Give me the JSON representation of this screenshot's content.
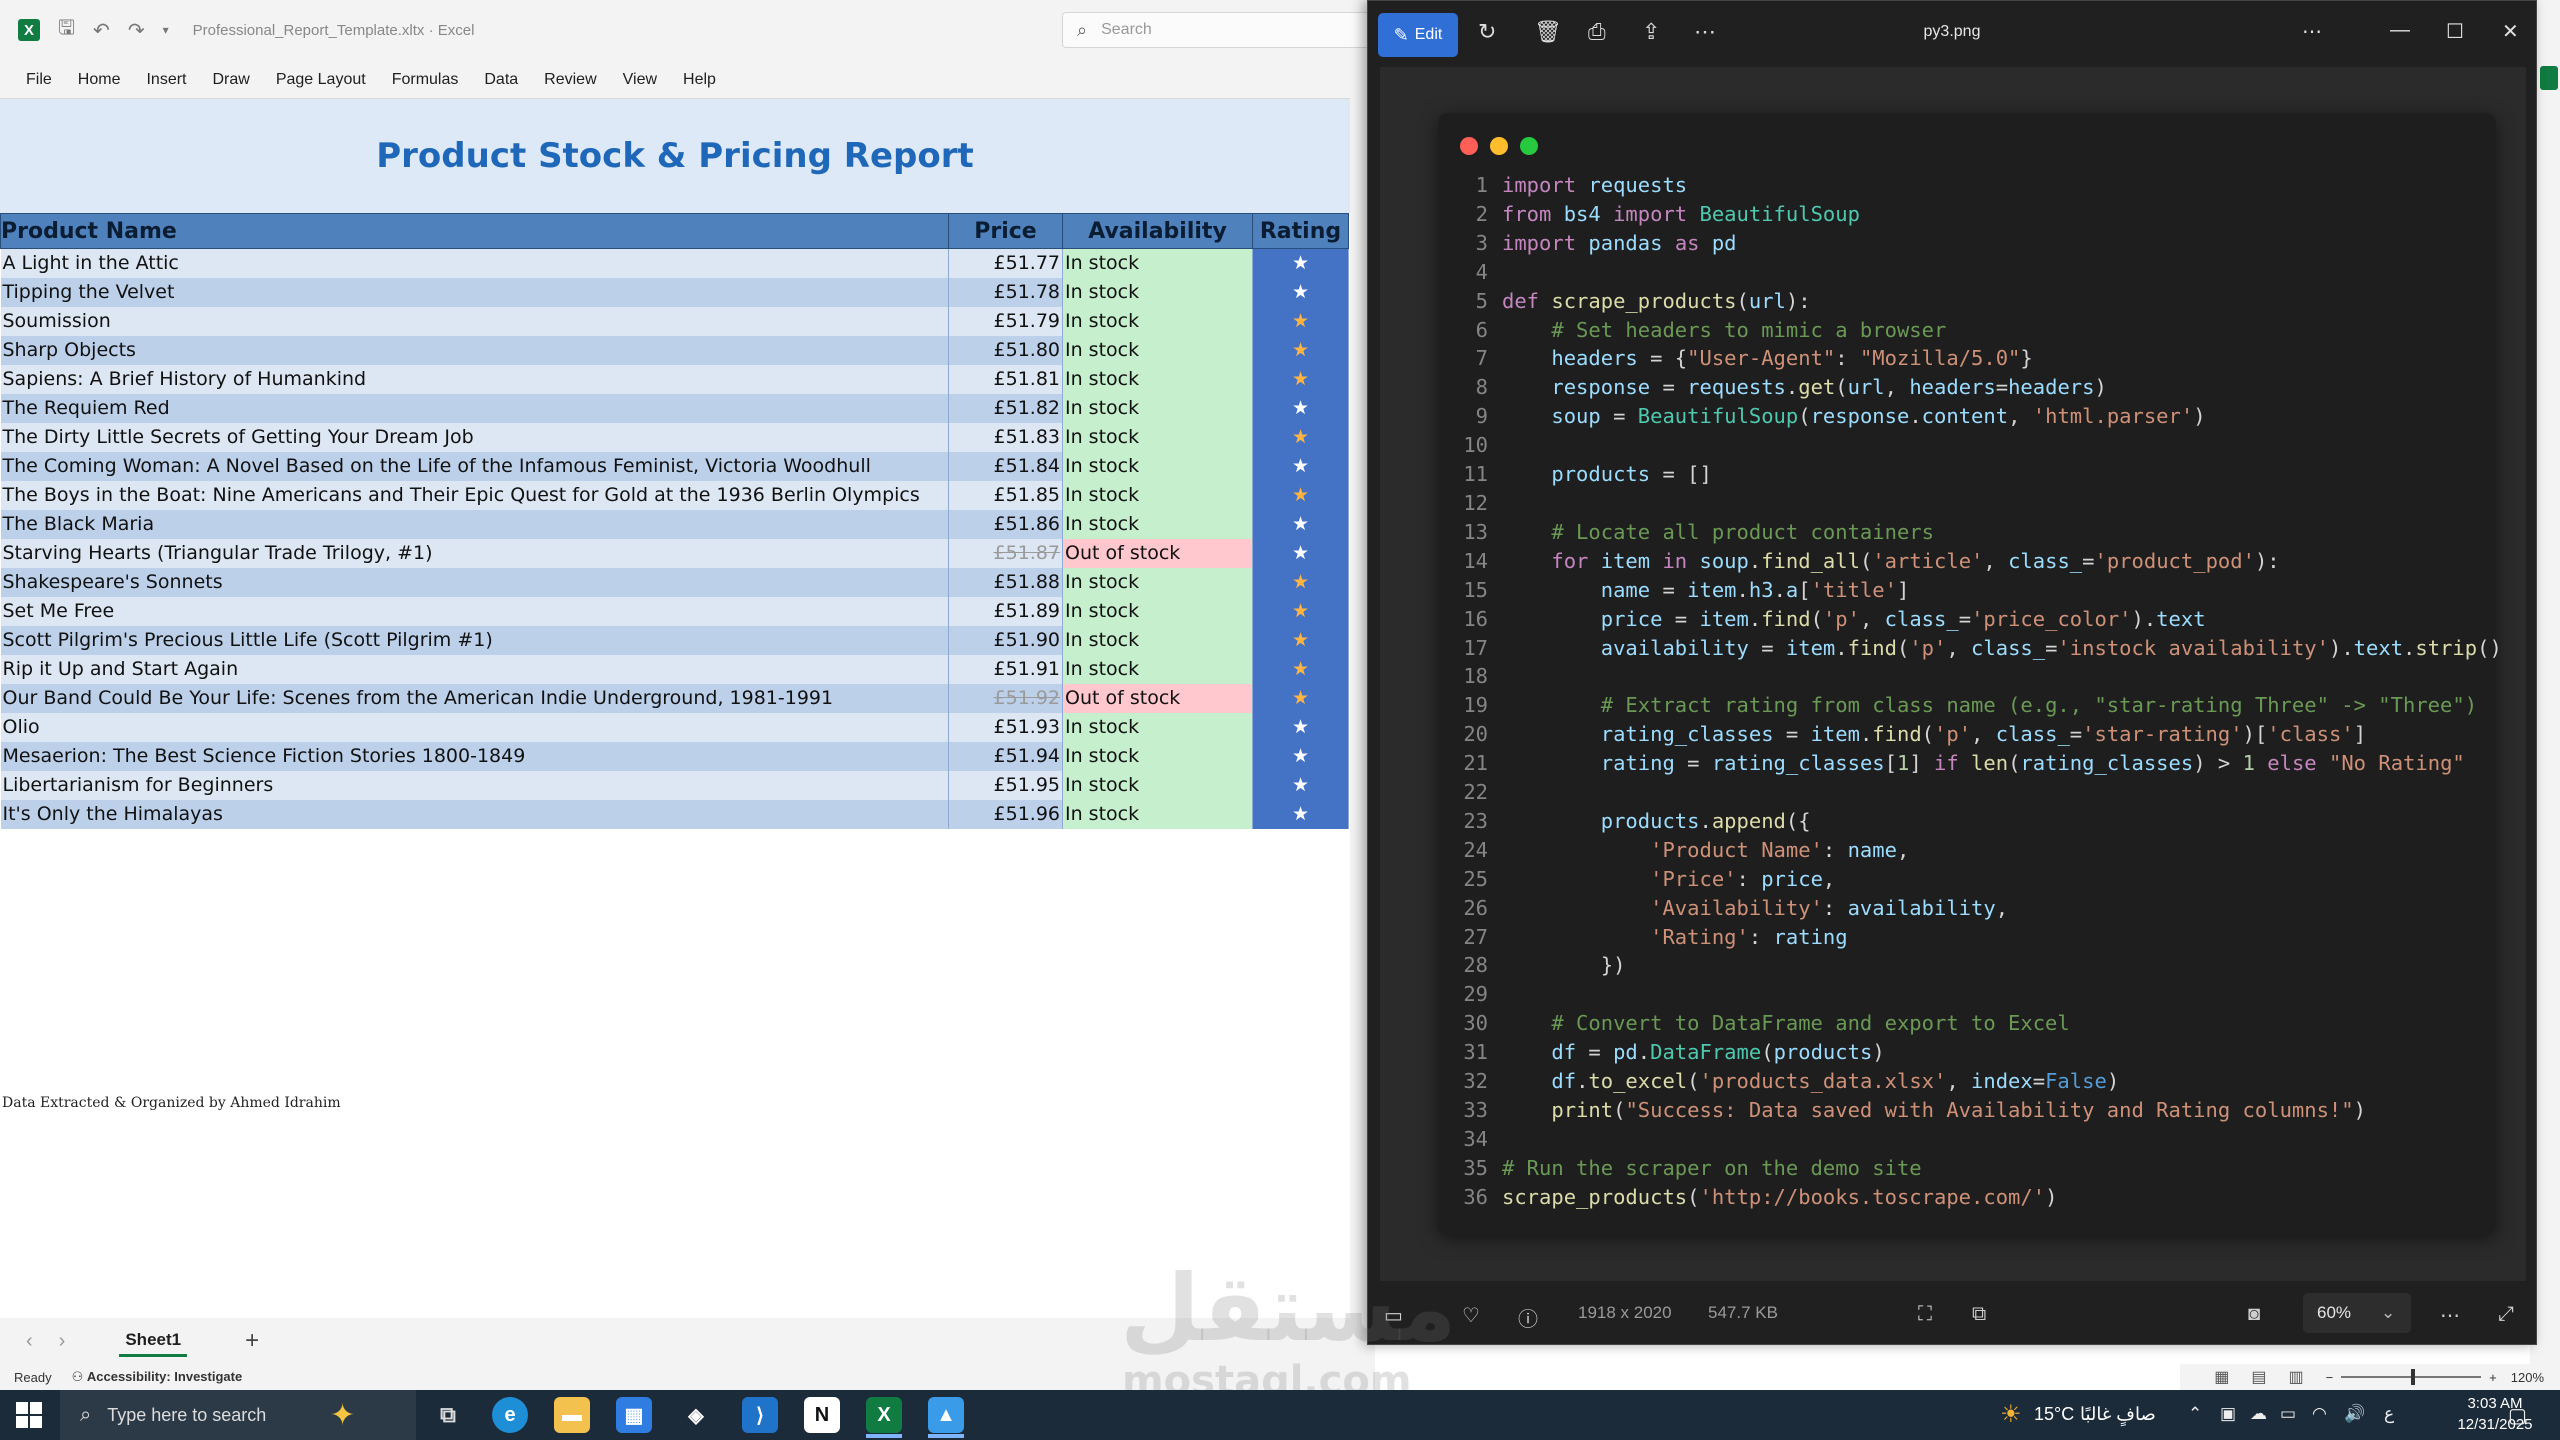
{
  "excel": {
    "file_name": "Professional_Report_Template.xltx",
    "app_name": "Excel",
    "search_placeholder": "Search",
    "menu": [
      "File",
      "Home",
      "Insert",
      "Draw",
      "Page Layout",
      "Formulas",
      "Data",
      "Review",
      "View",
      "Help"
    ],
    "report_title": "Product Stock & Pricing Report",
    "columns": [
      "Product Name",
      "Price",
      "Availability",
      "Rating"
    ],
    "rows": [
      {
        "name": "A Light in the Attic",
        "price": "£51.77",
        "availability": "In stock",
        "rating": "★",
        "star": "white"
      },
      {
        "name": "Tipping the Velvet",
        "price": "£51.78",
        "availability": "In stock",
        "rating": "★",
        "star": "white"
      },
      {
        "name": "Soumission",
        "price": "£51.79",
        "availability": "In stock",
        "rating": "★",
        "star": "orange"
      },
      {
        "name": "Sharp Objects",
        "price": "£51.80",
        "availability": "In stock",
        "rating": "★",
        "star": "orange"
      },
      {
        "name": "Sapiens: A Brief History of Humankind",
        "price": "£51.81",
        "availability": "In stock",
        "rating": "★",
        "star": "orange"
      },
      {
        "name": "The Requiem Red",
        "price": "£51.82",
        "availability": "In stock",
        "rating": "★",
        "star": "white"
      },
      {
        "name": "The Dirty Little Secrets of Getting Your Dream Job",
        "price": "£51.83",
        "availability": "In stock",
        "rating": "★",
        "star": "orange"
      },
      {
        "name": "The Coming Woman: A Novel Based on the Life of the Infamous Feminist, Victoria Woodhull",
        "price": "£51.84",
        "availability": "In stock",
        "rating": "★",
        "star": "white"
      },
      {
        "name": "The Boys in the Boat: Nine Americans and Their Epic Quest for Gold at the 1936 Berlin Olympics",
        "price": "£51.85",
        "availability": "In stock",
        "rating": "★",
        "star": "orange"
      },
      {
        "name": "The Black Maria",
        "price": "£51.86",
        "availability": "In stock",
        "rating": "★",
        "star": "white"
      },
      {
        "name": "Starving Hearts (Triangular Trade Trilogy, #1)",
        "price": "£51.87",
        "availability": "Out of stock",
        "rating": "★",
        "star": "white"
      },
      {
        "name": "Shakespeare's Sonnets",
        "price": "£51.88",
        "availability": "In stock",
        "rating": "★",
        "star": "orange"
      },
      {
        "name": "Set Me Free",
        "price": "£51.89",
        "availability": "In stock",
        "rating": "★",
        "star": "orange"
      },
      {
        "name": "Scott Pilgrim's Precious Little Life (Scott Pilgrim #1)",
        "price": "£51.90",
        "availability": "In stock",
        "rating": "★",
        "star": "orange"
      },
      {
        "name": "Rip it Up and Start Again",
        "price": "£51.91",
        "availability": "In stock",
        "rating": "★",
        "star": "orange"
      },
      {
        "name": "Our Band Could Be Your Life: Scenes from the American Indie Underground, 1981-1991",
        "price": "£51.92",
        "availability": "Out of stock",
        "rating": "★",
        "star": "orange"
      },
      {
        "name": "Olio",
        "price": "£51.93",
        "availability": "In stock",
        "rating": "★",
        "star": "white"
      },
      {
        "name": "Mesaerion: The Best Science Fiction Stories 1800-1849",
        "price": "£51.94",
        "availability": "In stock",
        "rating": "★",
        "star": "white"
      },
      {
        "name": "Libertarianism for Beginners",
        "price": "£51.95",
        "availability": "In stock",
        "rating": "★",
        "star": "white"
      },
      {
        "name": "It's Only the Himalayas",
        "price": "£51.96",
        "availability": "In stock",
        "rating": "★",
        "star": "white"
      }
    ],
    "credit": "Data Extracted & Organized by Ahmed Idrahim",
    "sheet_tab": "Sheet1",
    "add_sheet": "+",
    "status_ready": "Ready",
    "status_accessibility": "Accessibility: Investigate",
    "zoom_level": "120%"
  },
  "viewer": {
    "edit_label": "Edit",
    "file_name": "py3.png",
    "dimensions": "1918 x 2020",
    "file_size": "547.7 KB",
    "zoom": "60%"
  },
  "code_lines": [
    "import requests",
    "from bs4 import BeautifulSoup",
    "import pandas as pd",
    "",
    "def scrape_products(url):",
    "    # Set headers to mimic a browser",
    "    headers = {\"User-Agent\": \"Mozilla/5.0\"}",
    "    response = requests.get(url, headers=headers)",
    "    soup = BeautifulSoup(response.content, 'html.parser')",
    "",
    "    products = []",
    "",
    "    # Locate all product containers",
    "    for item in soup.find_all('article', class_='product_pod'):",
    "        name = item.h3.a['title']",
    "        price = item.find('p', class_='price_color').text",
    "        availability = item.find('p', class_='instock availability').text.strip()",
    "",
    "        # Extract rating from class name (e.g., \"star-rating Three\" -> \"Three\")",
    "        rating_classes = item.find('p', class_='star-rating')['class']",
    "        rating = rating_classes[1] if len(rating_classes) > 1 else \"No Rating\"",
    "",
    "        products.append({",
    "            'Product Name': name,",
    "            'Price': price,",
    "            'Availability': availability,",
    "            'Rating': rating",
    "        })",
    "",
    "    # Convert to DataFrame and export to Excel",
    "    df = pd.DataFrame(products)",
    "    df.to_excel('products_data.xlsx', index=False)",
    "    print(\"Success: Data saved with Availability and Rating columns!\")",
    "",
    "# Run the scraper on the demo site",
    "scrape_products('http://books.toscrape.com/')"
  ],
  "watermark": {
    "arabic": "مستقل",
    "latin": "mostaql.com"
  },
  "taskbar": {
    "search_placeholder": "Type here to search",
    "weather_temp": "15°C",
    "weather_text": "صافٍ غالبًا",
    "lang": "ع",
    "time": "3:03 AM",
    "date": "12/31/2025"
  },
  "colors": {
    "excel_green": "#107c41",
    "header_blue": "#4f81bd",
    "title_blue": "#1f67b8",
    "instock_bg": "#c6efce",
    "outstock_bg": "#ffc7ce",
    "edit_blue": "#2f6fd6"
  }
}
